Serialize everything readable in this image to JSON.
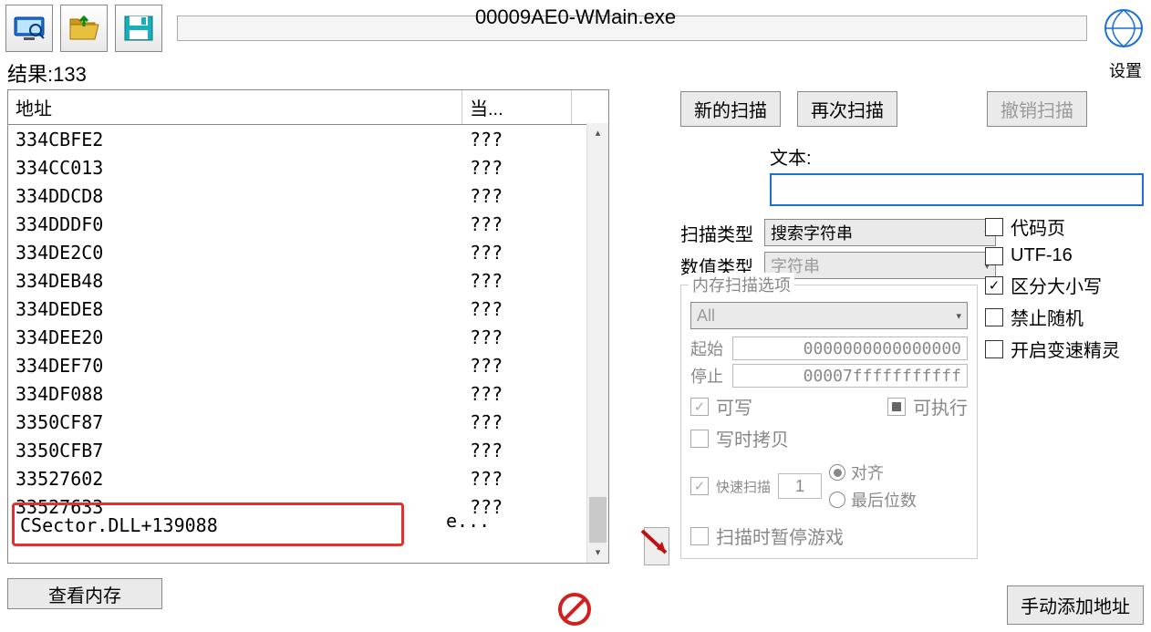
{
  "header": {
    "process_title": "00009AE0-WMain.exe",
    "settings_label": "设置"
  },
  "results": {
    "label_prefix": "结果:",
    "count": "133"
  },
  "table": {
    "col_address": "地址",
    "col_value": "当...",
    "rows": [
      {
        "addr": "334CBFE2",
        "val": "???"
      },
      {
        "addr": "334CC013",
        "val": "???"
      },
      {
        "addr": "334DDCD8",
        "val": "???"
      },
      {
        "addr": "334DDDF0",
        "val": "???"
      },
      {
        "addr": "334DE2C0",
        "val": "???"
      },
      {
        "addr": "334DEB48",
        "val": "???"
      },
      {
        "addr": "334DEDE8",
        "val": "???"
      },
      {
        "addr": "334DEE20",
        "val": "???"
      },
      {
        "addr": "334DEF70",
        "val": "???"
      },
      {
        "addr": "334DF088",
        "val": "???"
      },
      {
        "addr": "3350CF87",
        "val": "???"
      },
      {
        "addr": "3350CFB7",
        "val": "???"
      },
      {
        "addr": "33527602",
        "val": "???"
      },
      {
        "addr": "33527633",
        "val": "???"
      }
    ],
    "highlighted": {
      "addr": "CSector.DLL+139088",
      "val": "e..."
    }
  },
  "buttons": {
    "view_memory": "查看内存",
    "new_scan": "新的扫描",
    "next_scan": "再次扫描",
    "undo_scan": "撤销扫描",
    "manual_add": "手动添加地址"
  },
  "scan": {
    "text_label": "文本:",
    "search_value": "",
    "scan_type_label": "扫描类型",
    "scan_type_value": "搜索字符串",
    "value_type_label": "数值类型",
    "value_type_value": "字符串"
  },
  "checks": {
    "codepage": "代码页",
    "utf16": "UTF-16",
    "case_sensitive": "区分大小写",
    "no_random": "禁止随机",
    "speedhack": "开启变速精灵"
  },
  "mem_options": {
    "title": "内存扫描选项",
    "all": "All",
    "start_label": "起始",
    "start_value": "0000000000000000",
    "stop_label": "停止",
    "stop_value": "00007fffffffffff",
    "writable": "可写",
    "executable": "可执行",
    "copy_on_write": "写时拷贝",
    "fast_scan": "快速扫描",
    "fast_value": "1",
    "aligned": "对齐",
    "last_digits": "最后位数",
    "pause_game": "扫描时暂停游戏"
  }
}
